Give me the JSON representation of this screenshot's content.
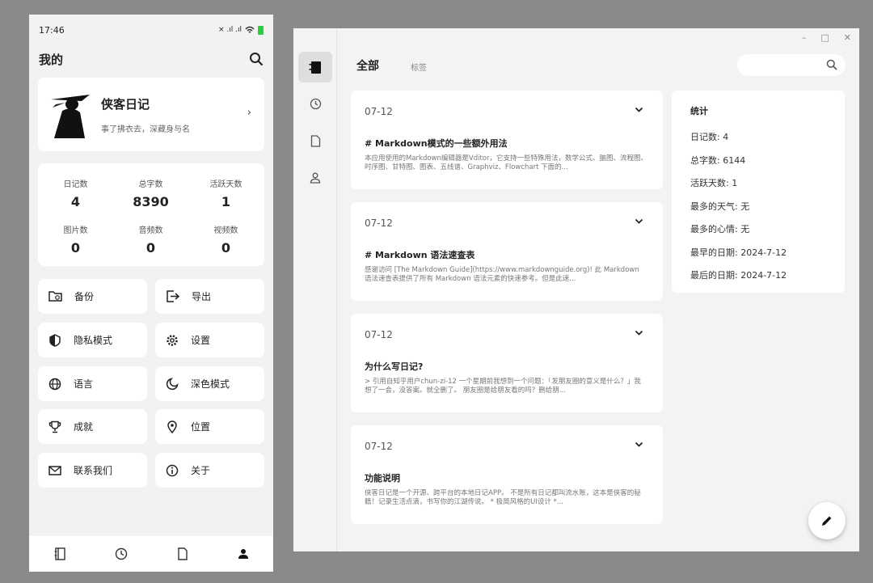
{
  "phone": {
    "status": {
      "time": "17:46",
      "signal": "× .ıl .ıl"
    },
    "header": {
      "title": "我的"
    },
    "profile": {
      "name": "侠客日记",
      "motto": "事了拂衣去，深藏身与名"
    },
    "stats": [
      {
        "label": "日记数",
        "value": "4"
      },
      {
        "label": "总字数",
        "value": "8390"
      },
      {
        "label": "活跃天数",
        "value": "1"
      },
      {
        "label": "图片数",
        "value": "0"
      },
      {
        "label": "音频数",
        "value": "0"
      },
      {
        "label": "视频数",
        "value": "0"
      }
    ],
    "menu": [
      {
        "label": "备份",
        "icon": "folder-sync-icon"
      },
      {
        "label": "导出",
        "icon": "export-icon"
      },
      {
        "label": "隐私模式",
        "icon": "privacy-shield-icon"
      },
      {
        "label": "设置",
        "icon": "gear-icon"
      },
      {
        "label": "语言",
        "icon": "globe-icon"
      },
      {
        "label": "深色模式",
        "icon": "moon-icon"
      },
      {
        "label": "成就",
        "icon": "trophy-icon"
      },
      {
        "label": "位置",
        "icon": "location-pin-icon"
      },
      {
        "label": "联系我们",
        "icon": "mail-icon"
      },
      {
        "label": "关于",
        "icon": "info-icon"
      }
    ]
  },
  "window": {
    "controls": {
      "minimize": "–",
      "maximize": "□",
      "close": "✕"
    },
    "tabs": {
      "all": "全部",
      "tags": "标签"
    },
    "entries": [
      {
        "date": "07-12",
        "title": "# Markdown模式的一些额外用法",
        "excerpt": "本应用使用的Markdown编辑器是Vditor，它支持一些特殊用法，数学公式、脑图、流程图、时序图、甘特图、图表、五线谱、Graphviz、Flowchart 下面的..."
      },
      {
        "date": "07-12",
        "title": "# Markdown 语法速查表",
        "excerpt": "感谢访问 [The Markdown Guide](https://www.markdownguide.org)! 此 Markdown 语法速查表提供了所有 Markdown 语法元素的快速参考。但是此速..."
      },
      {
        "date": "07-12",
        "title": "为什么写日记?",
        "excerpt": "> 引用自知乎用户chun-zi-12 一个星期前我想到一个问题：「发朋友圈的意义是什么？」我想了一会，没答案。就全删了。 朋友圈是给朋友看的吗？删给朋..."
      },
      {
        "date": "07-12",
        "title": "功能说明",
        "excerpt": "侠客日记是一个开源、跨平台的本地日记APP。 不是所有日记都叫流水账，这本是侠客的秘籍！记录生活点滴，书写你的江湖传说。 * 极简风格的UI设计 *..."
      }
    ],
    "statistics": {
      "title": "统计",
      "rows": [
        "日记数: 4",
        "总字数: 6144",
        "活跃天数: 1",
        "最多的天气:   无",
        "最多的心情:   无",
        "最早的日期: 2024-7-12",
        "最后的日期: 2024-7-12"
      ]
    }
  }
}
